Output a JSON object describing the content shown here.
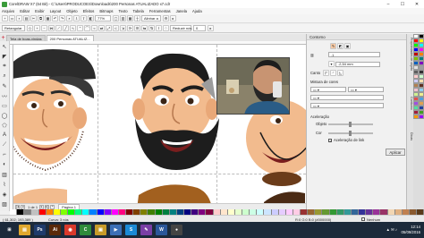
{
  "window": {
    "title": "CorelDRAW X7 (64 Bit) - C:\\Users\\PRODUCOES\\Downloads\\200 Personas ATUALIZADO x7.cdr",
    "minimize": "–",
    "maximize": "☐",
    "close": "✕"
  },
  "menu": [
    "Arquivo",
    "Editar",
    "Exibir",
    "Layout",
    "Objeto",
    "Efeitos",
    "Bitmaps",
    "Texto",
    "Tabela",
    "Ferramentas",
    "Janela",
    "Ajuda"
  ],
  "toolbar": {
    "zoom": "77%",
    "snap": "Alinhar a",
    "new_label": "+"
  },
  "property_bar": {
    "shape_select": "Retangular",
    "reduce_nodes": "Reduzir nós",
    "nodes_value": "0"
  },
  "tabs": {
    "plus": "+",
    "items": [
      "Tela de boas-vindas",
      "200 Personas ATUALIZ..."
    ]
  },
  "page_nav": {
    "position": "1 de 1",
    "page_label": "Página 1"
  },
  "docker": {
    "title": "Contorno",
    "width_value": ".1",
    "size_value": ".2,54 mm",
    "corners_label": "Canto",
    "color_mix_label": "Mistura de cores",
    "acceleration_label": "Aceleração",
    "object_label": "Objeto",
    "fill_label": "Cor",
    "link_checkbox": "Aceleração de link",
    "apply_button": "Aplicar"
  },
  "side_tabs": [
    "Propriedades de objeto",
    "Contorno",
    "Dicas"
  ],
  "status": {
    "coords": "( 61,302; 193,389 )",
    "curve": "Curva: 3 nós",
    "fill_info": "R:0 G:0 B:0 (#000000)",
    "outline_info": "Nenhum"
  },
  "taskbar": {
    "apps": [
      {
        "name": "Windows",
        "glyph": "⊞",
        "color": "#1c2a3a"
      },
      {
        "name": "Explorer",
        "glyph": "▤",
        "color": "#e0a82e"
      },
      {
        "name": "Photoshop",
        "glyph": "Ps",
        "color": "#1f3b6b"
      },
      {
        "name": "Illustrator",
        "glyph": "Ai",
        "color": "#5a2a0a"
      },
      {
        "name": "Chrome",
        "glyph": "◉",
        "color": "#d9392b"
      },
      {
        "name": "CorelDRAW",
        "glyph": "C",
        "color": "#2e8b3a"
      },
      {
        "name": "Folder",
        "glyph": "▣",
        "color": "#c79b2a"
      },
      {
        "name": "Media",
        "glyph": "▶",
        "color": "#3b6fb6"
      },
      {
        "name": "Skype",
        "glyph": "S",
        "color": "#1b8ad6"
      },
      {
        "name": "App",
        "glyph": "✎",
        "color": "#7a3fa5"
      },
      {
        "name": "Word",
        "glyph": "W",
        "color": "#2b579a"
      },
      {
        "name": "OBS",
        "glyph": "●",
        "color": "#444"
      }
    ],
    "systray": "▲ ✉ ♪",
    "time": "12:14",
    "date": "05/09/2016"
  },
  "colors": {
    "accent": "#c23a2a",
    "taskbar": "#1c2a3a",
    "canvas": "#ffffff"
  },
  "palette": [
    "#ffffff",
    "#000000",
    "#7f7f7f",
    "#c0c0c0",
    "#ff0000",
    "#ff8000",
    "#ffff00",
    "#80ff00",
    "#00ff00",
    "#00ff80",
    "#00ffff",
    "#0080ff",
    "#0000ff",
    "#8000ff",
    "#ff00ff",
    "#ff0080",
    "#800000",
    "#804000",
    "#808000",
    "#408000",
    "#008000",
    "#008040",
    "#008080",
    "#004080",
    "#000080",
    "#400080",
    "#800080",
    "#800040",
    "#ffcccc",
    "#ffe5cc",
    "#ffffcc",
    "#e5ffcc",
    "#ccffcc",
    "#ccffe5",
    "#ccffff",
    "#cce5ff",
    "#ccccff",
    "#e5ccff",
    "#ffccff",
    "#ffcce5",
    "#993333",
    "#996633",
    "#999933",
    "#669933",
    "#339933",
    "#339966",
    "#339999",
    "#336699",
    "#333399",
    "#663399",
    "#993399",
    "#993366",
    "#f2d6b3",
    "#e0b080",
    "#c08050",
    "#8a5a30",
    "#5a3a1a"
  ],
  "palette_v": [
    "#ffffff",
    "#000000",
    "#ff0000",
    "#ffff00",
    "#00ff00",
    "#00ffff",
    "#0000ff",
    "#ff00ff",
    "#c00000",
    "#ff8000",
    "#80c000",
    "#008080",
    "#0060c0",
    "#8000c0",
    "#e0e0e0",
    "#a0a0a0",
    "#606060",
    "#303030",
    "#ffcccc",
    "#ccffcc",
    "#ccccff",
    "#ffe0b0",
    "#b08050",
    "#603020",
    "#f0c0d0",
    "#90d0f0",
    "#d0f090",
    "#f0f090",
    "#e05050",
    "#50a0e0",
    "#a050e0",
    "#e0a050",
    "#50e0a0",
    "#2040a0",
    "#a02040",
    "#40a020",
    "#ff9900",
    "#9900ff"
  ]
}
